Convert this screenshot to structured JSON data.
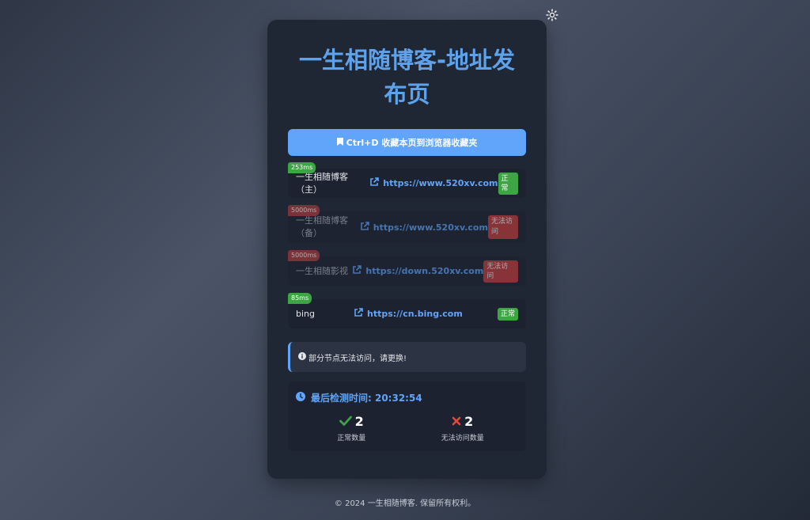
{
  "title": "一生相随博客-地址发布页",
  "bookmark": {
    "label": "Ctrl+D 收藏本页到浏览器收藏夹"
  },
  "links": [
    {
      "latency": "253ms",
      "name": "一生相随博客（主）",
      "url": "https://www.520xv.com",
      "status": "正常"
    },
    {
      "latency": "5000ms",
      "name": "一生相随博客（备）",
      "url": "https://www.520xv.com",
      "status": "无法访问"
    },
    {
      "latency": "5000ms",
      "name": "一生相随影视",
      "url": "https://down.520xv.com",
      "status": "无法访问"
    },
    {
      "latency": "85ms",
      "name": "bing",
      "url": "https://cn.bing.com",
      "status": "正常"
    }
  ],
  "notice": {
    "text": "部分节点无法访问，请更换!"
  },
  "stats": {
    "last_check": "最后检测时间: 20:32:54",
    "ok_count": "2",
    "ok_label": "正常数量",
    "bad_count": "2",
    "bad_label": "无法访问数量"
  },
  "footer": {
    "text": "© 2024 一生相随博客. 保留所有权利。"
  },
  "colors": {
    "accent": "#60a5fa",
    "ok": "#3ea544",
    "bad": "#c73b3b"
  }
}
